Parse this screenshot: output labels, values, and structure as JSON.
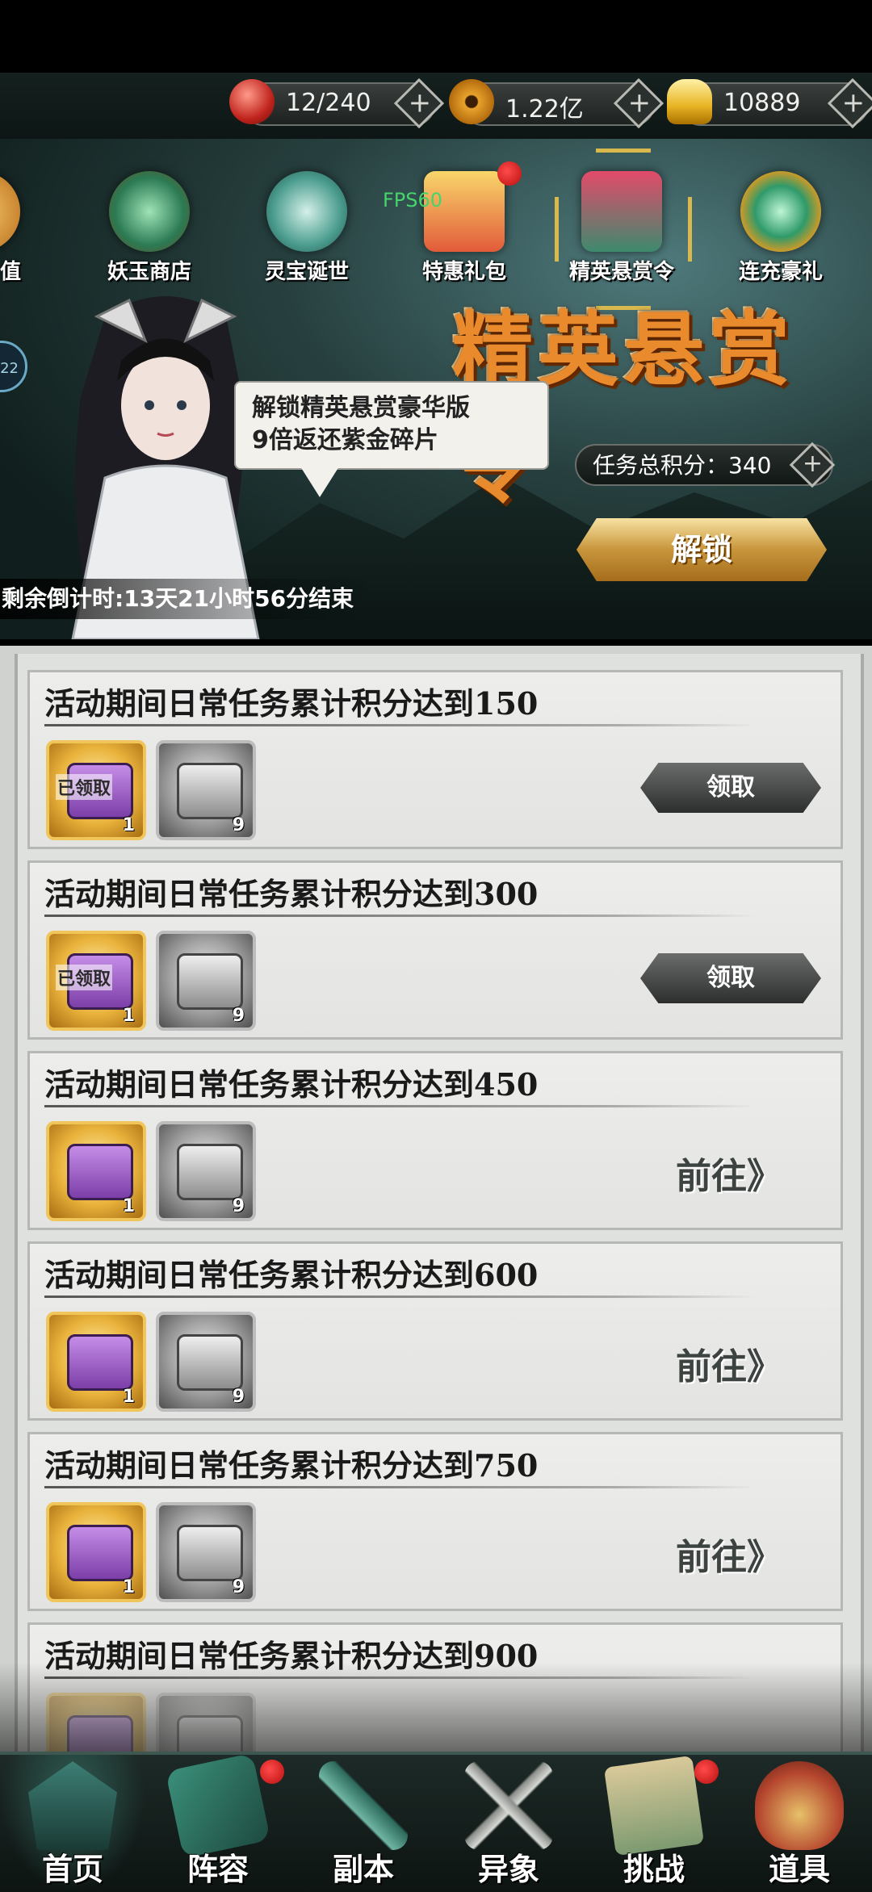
{
  "resources": [
    {
      "icon": "red-orb-icon",
      "value": "12/240"
    },
    {
      "icon": "copper-coin-icon",
      "value": "1.22亿"
    },
    {
      "icon": "gold-ingot-icon",
      "value": "10889"
    }
  ],
  "events": [
    {
      "label": "值",
      "icon": "recharge-icon"
    },
    {
      "label": "妖玉商店",
      "icon": "jade-shop-icon"
    },
    {
      "label": "灵宝诞世",
      "icon": "spirit-treasure-icon"
    },
    {
      "label": "特惠礼包",
      "icon": "gift-box-icon"
    },
    {
      "label": "精英悬赏令",
      "icon": "bounty-order-icon"
    },
    {
      "label": "连充豪礼",
      "icon": "continuous-recharge-icon"
    }
  ],
  "fps": "FPS60",
  "banner": {
    "title": "精英悬赏令",
    "speech_line1": "解锁精英悬赏豪华版",
    "speech_line2": "9倍返还紫金碎片",
    "score_label": "任务总积分：340",
    "unlock_label": "解锁",
    "countdown": "剩余倒计时:13天21小时56分结束",
    "side_badge": "22"
  },
  "tasks": [
    {
      "title": "活动期间日常任务累计积分达到150",
      "reward1_count": "1",
      "reward1_tag": "已领取",
      "reward2_count": "9",
      "action": "领取",
      "action_type": "claim"
    },
    {
      "title": "活动期间日常任务累计积分达到300",
      "reward1_count": "1",
      "reward1_tag": "已领取",
      "reward2_count": "9",
      "action": "领取",
      "action_type": "claim"
    },
    {
      "title": "活动期间日常任务累计积分达到450",
      "reward1_count": "1",
      "reward1_tag": "",
      "reward2_count": "9",
      "action": "前往》",
      "action_type": "goto"
    },
    {
      "title": "活动期间日常任务累计积分达到600",
      "reward1_count": "1",
      "reward1_tag": "",
      "reward2_count": "9",
      "action": "前往》",
      "action_type": "goto"
    },
    {
      "title": "活动期间日常任务累计积分达到750",
      "reward1_count": "1",
      "reward1_tag": "",
      "reward2_count": "9",
      "action": "前往》",
      "action_type": "goto"
    },
    {
      "title": "活动期间日常任务累计积分达到900",
      "reward1_count": "",
      "reward1_tag": "",
      "reward2_count": "",
      "action": "",
      "action_type": "none"
    }
  ],
  "nav": [
    {
      "label": "首页",
      "icon": "home-pavilion-icon"
    },
    {
      "label": "阵容",
      "icon": "lineup-book-icon"
    },
    {
      "label": "副本",
      "icon": "dungeon-sword-icon"
    },
    {
      "label": "异象",
      "icon": "crossed-swords-icon"
    },
    {
      "label": "挑战",
      "icon": "challenge-scroll-icon"
    },
    {
      "label": "道具",
      "icon": "item-bag-icon"
    }
  ],
  "colors": {
    "accent_gold": "#d9b84e",
    "title_orange": "#e98a2c",
    "badge_red": "#d31818",
    "fps_green": "#46d46b"
  }
}
